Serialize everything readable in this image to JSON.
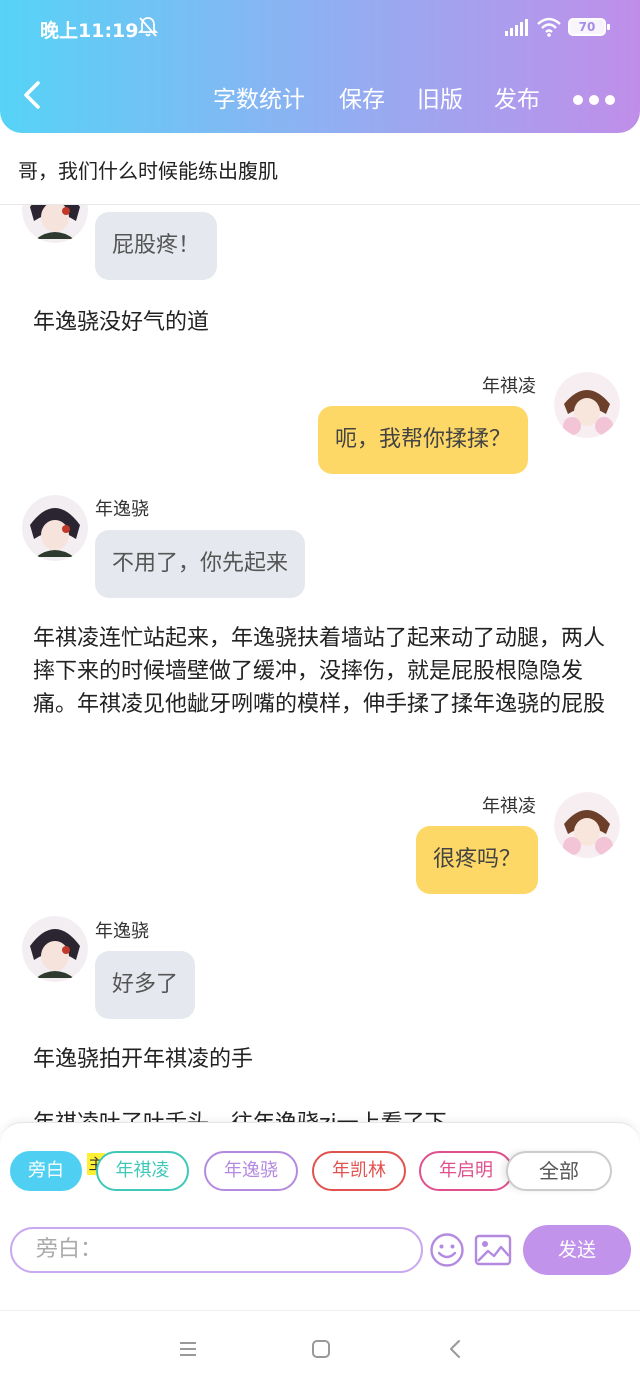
{
  "status_bar": {
    "time": "晚上11:19",
    "battery": "70"
  },
  "header": {
    "nav": [
      "字数统计",
      "保存",
      "旧版",
      "发布"
    ]
  },
  "story_title": "哥，我们什么时候能练出腹肌",
  "messages": [
    {
      "type": "left",
      "text": "屁股疼！"
    },
    {
      "type": "narration",
      "text": "年逸骁没好气的道"
    },
    {
      "type": "right",
      "name": "年祺凌",
      "text": "呃，我帮你揉揉？"
    },
    {
      "type": "left",
      "name": "年逸骁",
      "text": "不用了，你先起来"
    },
    {
      "type": "narration",
      "text": "年祺凌连忙站起来，年逸骁扶着墙站了起来动了动腿，两人摔下来的时候墙壁做了缓冲，没摔伤，就是屁股根隐隐发痛。年祺凌见他龇牙咧嘴的模样，伸手揉了揉年逸骁的屁股"
    },
    {
      "type": "right",
      "name": "年祺凌",
      "text": "很疼吗？"
    },
    {
      "type": "left",
      "name": "年逸骁",
      "text": "好多了"
    },
    {
      "type": "narration",
      "text": "年逸骁拍开年祺凌的手"
    },
    {
      "type": "narration",
      "text": "年祺凌吐了吐舌头，往年逸骁zi一上看了下"
    }
  ],
  "roles": [
    {
      "label": "旁白",
      "color": "#4fd0f2",
      "active": true
    },
    {
      "label": "年祺凌",
      "color": "#3fc8b8",
      "active": false
    },
    {
      "label": "年逸骁",
      "color": "#b48ae0",
      "active": false
    },
    {
      "label": "年凯林",
      "color": "#e2524f",
      "active": false
    },
    {
      "label": "年启明",
      "color": "#e0508f",
      "active": false
    },
    {
      "label": "全部",
      "color": "#cccccc",
      "active": false
    }
  ],
  "main_tag": "主",
  "input": {
    "placeholder": "旁白："
  },
  "send_label": "发送"
}
